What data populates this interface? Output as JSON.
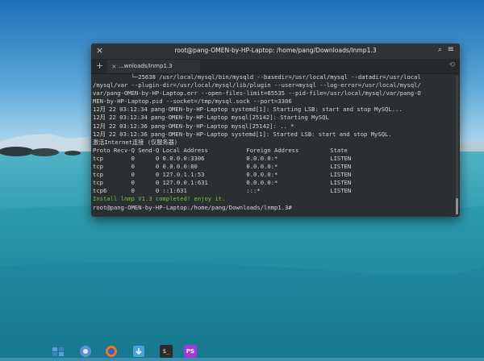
{
  "window": {
    "title": "root@pang-OMEN-by-HP-Laptop: /home/pang/Downloads/lnmp1.3",
    "tab_label": "...wnloads/lnmp1.3",
    "close_glyph": "×",
    "tab_close_glyph": "×",
    "add_tab_glyph": "+",
    "search_glyph": "⌕",
    "menu_glyph": "≡",
    "history_glyph": "⟲"
  },
  "terminal": {
    "lines": [
      "           └─25638 /usr/local/mysql/bin/mysqld --basedir=/usr/local/mysql --datadir=/usr/local",
      "/mysql/var --plugin-dir=/usr/local/mysql/lib/plugin --user=mysql --log-error=/usr/local/mysql/",
      "var/pang-OMEN-by-HP-Laptop.err --open-files-limit=65535 --pid-file=/usr/local/mysql/var/pang-O",
      "MEN-by-HP-Laptop.pid --socket=/tmp/mysql.sock --port=3306",
      "",
      "12月 22 03:12:34 pang-OMEN-by-HP-Laptop systemd[1]: Starting LSB: start and stop MySQL...",
      "12月 22 03:12:34 pang-OMEN-by-HP-Laptop mysql[25142]: Starting MySQL",
      "12月 22 03:12:36 pang-OMEN-by-HP-Laptop mysql[25142]: .. *",
      "12月 22 03:12:36 pang-OMEN-by-HP-Laptop systemd[1]: Started LSB: start and stop MySQL.",
      "激活Internet连接 (仅服务器)",
      "Proto Recv-Q Send-Q Local Address           Foreign Address         State",
      "tcp        0      0 0.0.0.0:3306            0.0.0.0:*               LISTEN",
      "tcp        0      0 0.0.0.0:80              0.0.0.0:*               LISTEN",
      "tcp        0      0 127.0.1.1:53            0.0.0.0:*               LISTEN",
      "tcp        0      0 127.0.0.1:631           0.0.0.0:*               LISTEN",
      "tcp6       0      0 ::1:631                 :::*                    LISTEN"
    ],
    "success_line": "Install lnmp V1.3 completed! enjoy it.",
    "prompt_line": "root@pang-OMEN-by-HP-Laptop:/home/pang/Downloads/lnmp1.3#"
  },
  "dock": {
    "items": [
      {
        "name": "workspaces-icon",
        "color": "#3f7fc5"
      },
      {
        "name": "chrome-icon",
        "color": "#5b8fd6"
      },
      {
        "name": "firefox-icon",
        "color": "#e8772e"
      },
      {
        "name": "download-icon",
        "color": "#4aa3df"
      },
      {
        "name": "terminal-icon",
        "color": "#2a2a2a"
      },
      {
        "name": "phpstorm-icon",
        "color": "#a23bd1"
      }
    ],
    "terminal_label": "$_",
    "phpstorm_label": "PS"
  }
}
